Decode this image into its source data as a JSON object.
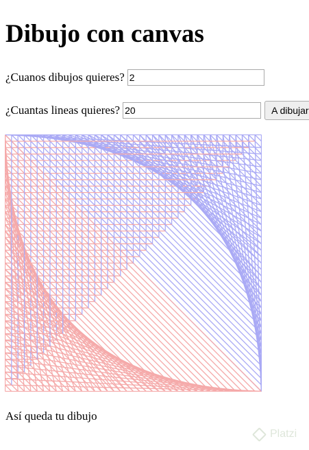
{
  "heading": "Dibujo con canvas",
  "form": {
    "drawings_label": "¿Cuanos dibujos quieres?",
    "drawings_value": "2",
    "lines_label": "¿Cuantas lineas quieres?",
    "lines_value": "20",
    "button_label": "A dibujar"
  },
  "canvas": {
    "drawings": 2,
    "lines": 20,
    "colors": {
      "border": "#aaaaf5",
      "blue": "#aaaaf5",
      "red": "#f5aaaa"
    }
  },
  "caption": "Así queda tu dibujo",
  "watermark": "Platzi"
}
